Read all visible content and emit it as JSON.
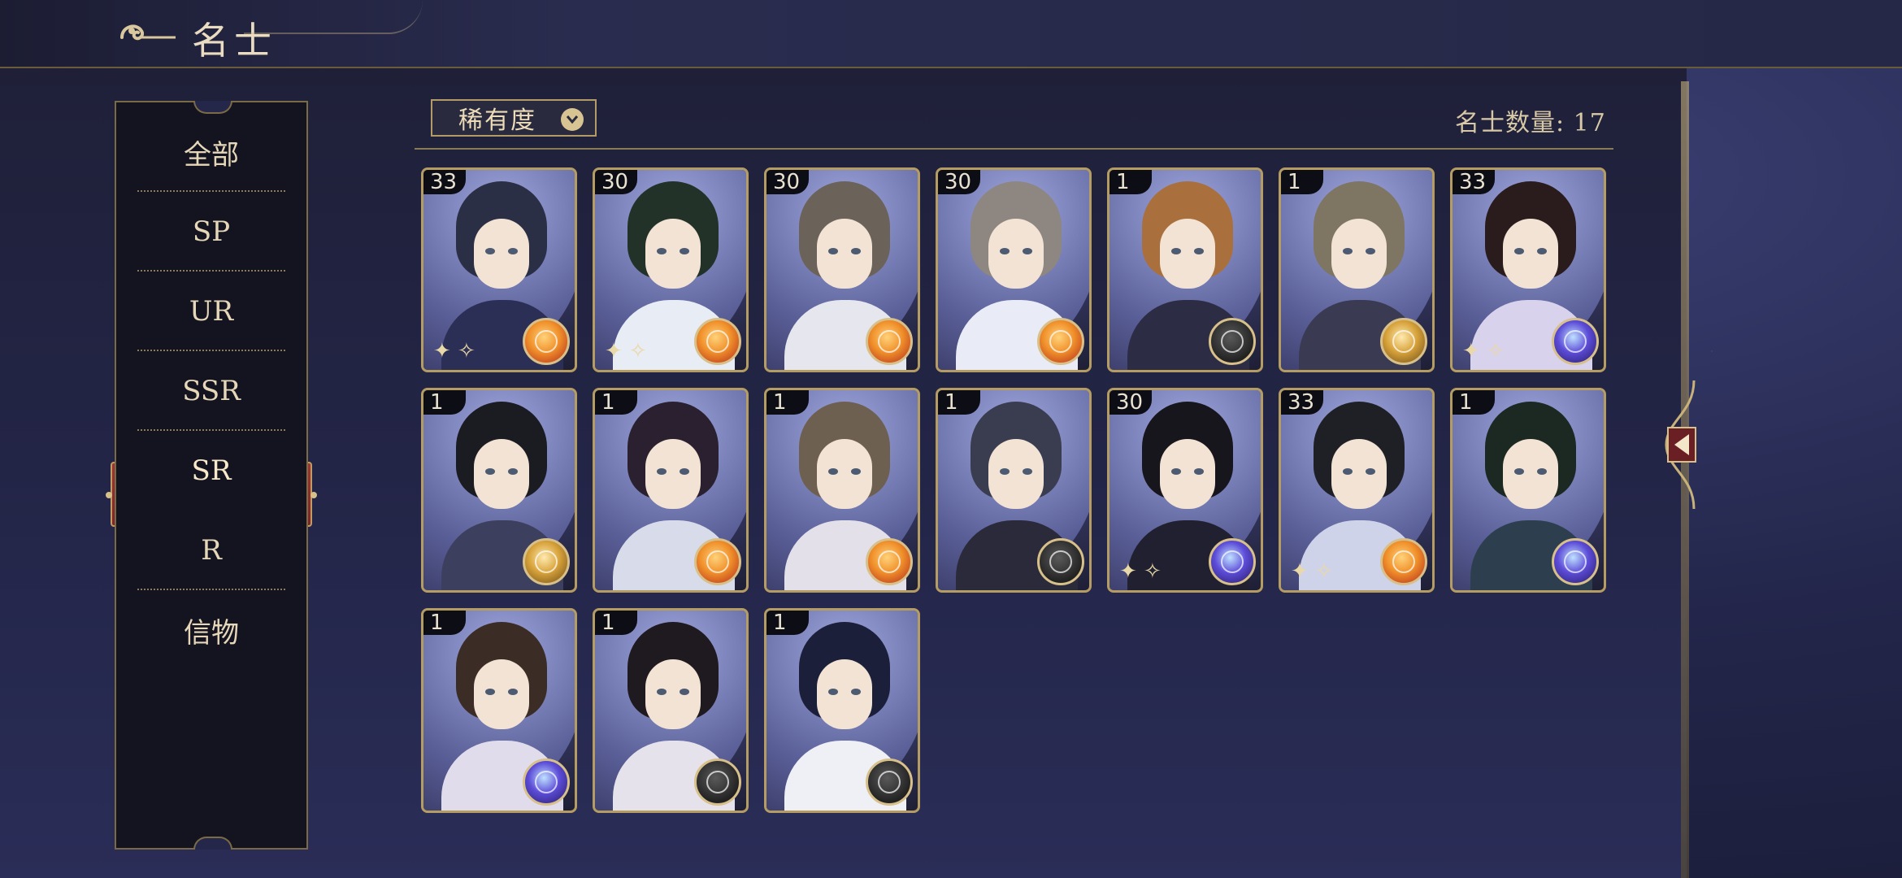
{
  "header": {
    "title": "名士"
  },
  "sidebar": {
    "items": [
      {
        "label": "全部"
      },
      {
        "label": "SP"
      },
      {
        "label": "UR"
      },
      {
        "label": "SSR"
      },
      {
        "label": "SR",
        "active": true
      },
      {
        "label": "R"
      },
      {
        "label": "信物"
      }
    ]
  },
  "filter": {
    "label": "稀有度"
  },
  "count": {
    "text": "名士数量: 17"
  },
  "cards": [
    {
      "level": "33",
      "badge": "sun-icon",
      "hair": "#2b2f45",
      "outfit": "#2c2f55",
      "sparkle": true
    },
    {
      "level": "30",
      "badge": "sun-icon",
      "hair": "#223228",
      "outfit": "#e8ecf4",
      "sparkle": true
    },
    {
      "level": "30",
      "badge": "sun-icon",
      "hair": "#6b6259",
      "outfit": "#e6e7ee",
      "sparkle": false
    },
    {
      "level": "30",
      "badge": "sun-icon",
      "hair": "#8e8680",
      "outfit": "#e9ecf6",
      "sparkle": false
    },
    {
      "level": "1",
      "badge": "compass-icon",
      "hair": "#a9703e",
      "outfit": "#2d2c45",
      "sparkle": false
    },
    {
      "level": "1",
      "badge": "gold-orb-icon",
      "hair": "#7e7663",
      "outfit": "#3a3a52",
      "sparkle": false
    },
    {
      "level": "33",
      "badge": "galaxy-icon",
      "hair": "#2a1c1c",
      "outfit": "#d8d2ec",
      "sparkle": true
    },
    {
      "level": "1",
      "badge": "gold-orb-icon",
      "hair": "#1b1b22",
      "outfit": "#3d3f5e",
      "sparkle": false
    },
    {
      "level": "1",
      "badge": "sun-icon",
      "hair": "#2a2030",
      "outfit": "#d8dcea",
      "sparkle": false
    },
    {
      "level": "1",
      "badge": "sun-icon",
      "hair": "#6e6051",
      "outfit": "#e3e0ea",
      "sparkle": false
    },
    {
      "level": "1",
      "badge": "compass-icon",
      "hair": "#3a3d50",
      "outfit": "#2a2a3a",
      "sparkle": false
    },
    {
      "level": "30",
      "badge": "galaxy-icon",
      "hair": "#17161c",
      "outfit": "#202030",
      "sparkle": true
    },
    {
      "level": "33",
      "badge": "sun-icon",
      "hair": "#1f2026",
      "outfit": "#cfd3ea",
      "sparkle": true
    },
    {
      "level": "1",
      "badge": "galaxy-icon",
      "hair": "#1c2822",
      "outfit": "#2d3f4f",
      "sparkle": false
    },
    {
      "level": "1",
      "badge": "galaxy-icon",
      "hair": "#3b2c25",
      "outfit": "#e0dceb",
      "sparkle": false
    },
    {
      "level": "1",
      "badge": "compass-icon",
      "hair": "#1f1a1f",
      "outfit": "#e5e2ec",
      "sparkle": false
    },
    {
      "level": "1",
      "badge": "compass-icon",
      "hair": "#1b1f3a",
      "outfit": "#eef0f6",
      "sparkle": false
    }
  ],
  "colors": {
    "accent_gold": "#b59c62",
    "active_tab": "#9c3631",
    "panel": "#1f2038"
  }
}
